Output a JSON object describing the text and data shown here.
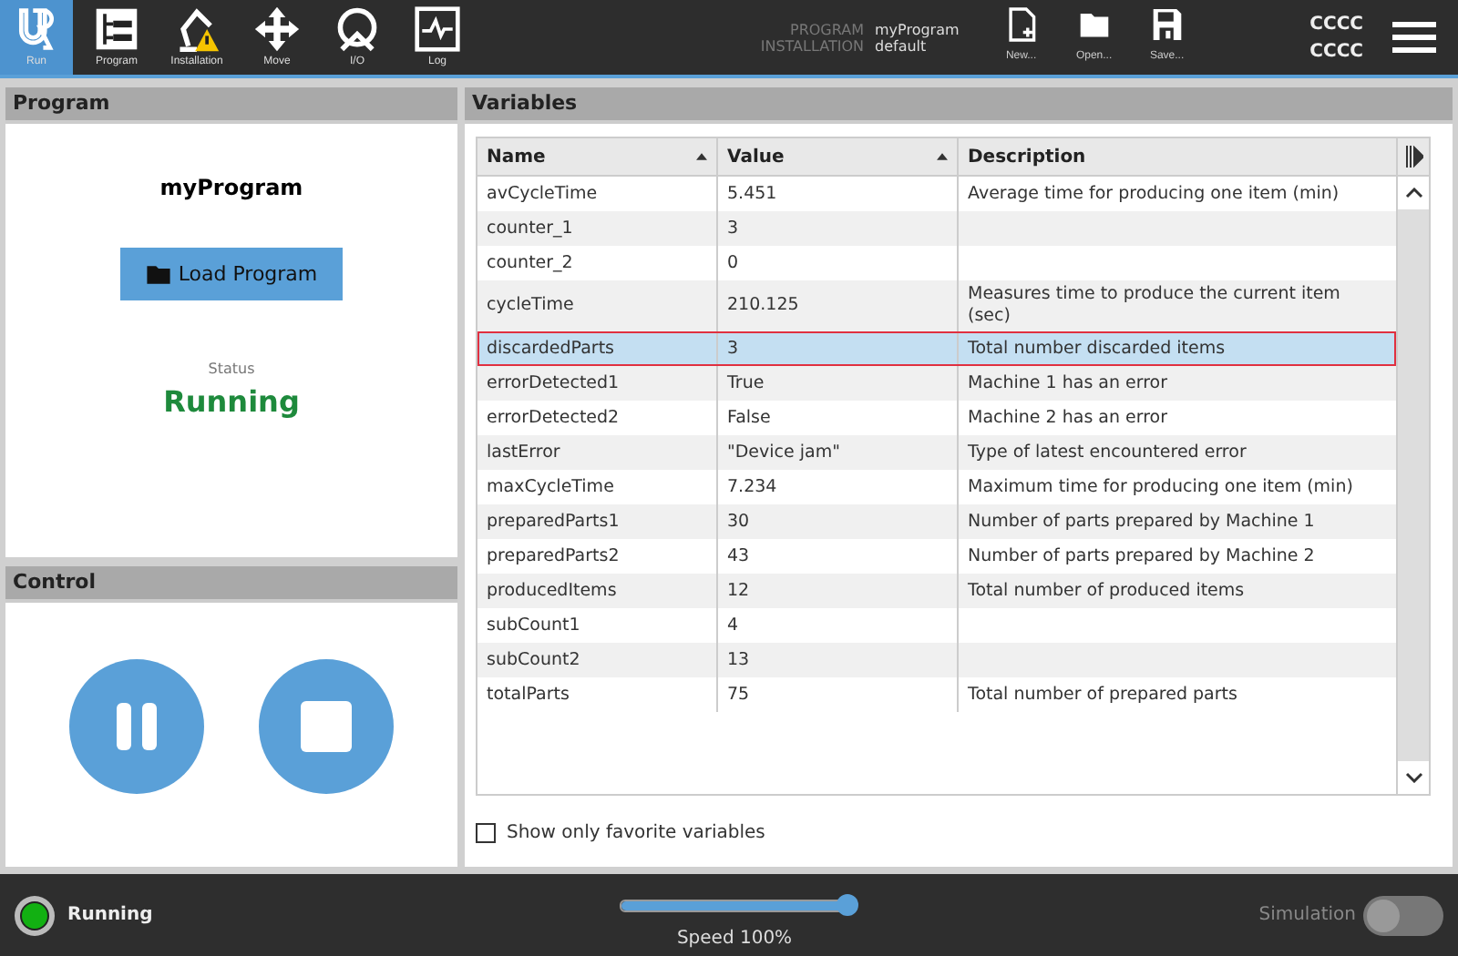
{
  "nav": [
    {
      "label": "Run",
      "kind": "logo",
      "selected": true
    },
    {
      "label": "Program",
      "kind": "program",
      "selected": false
    },
    {
      "label": "Installation",
      "kind": "installation",
      "selected": false
    },
    {
      "label": "Move",
      "kind": "move",
      "selected": false
    },
    {
      "label": "I/O",
      "kind": "io",
      "selected": false
    },
    {
      "label": "Log",
      "kind": "log",
      "selected": false
    }
  ],
  "header_info": [
    {
      "label": "PROGRAM",
      "value": "myProgram"
    },
    {
      "label": "INSTALLATION",
      "value": "default"
    }
  ],
  "file_buttons": [
    {
      "label": "New...",
      "kind": "new"
    },
    {
      "label": "Open...",
      "kind": "open"
    },
    {
      "label": "Save...",
      "kind": "save"
    }
  ],
  "robot_name": [
    "CCCC",
    "CCCC"
  ],
  "program_panel": {
    "title": "Program",
    "program_name": "myProgram",
    "load_button": "Load Program",
    "status_label": "Status",
    "status": "Running"
  },
  "control_panel": {
    "title": "Control",
    "buttons": [
      {
        "kind": "pause"
      },
      {
        "kind": "stop"
      }
    ]
  },
  "variables": {
    "title": "Variables",
    "columns": [
      {
        "label": "Name",
        "sortable": true
      },
      {
        "label": "Value",
        "sortable": true
      },
      {
        "label": "Description",
        "sortable": false
      }
    ],
    "rows": [
      {
        "name": "avCycleTime",
        "value": "5.451",
        "description": "Average time for producing one item (min)",
        "selected": false,
        "highlighted": false
      },
      {
        "name": "counter_1",
        "value": "3",
        "description": "",
        "selected": false,
        "highlighted": false
      },
      {
        "name": "counter_2",
        "value": "0",
        "description": "",
        "selected": false,
        "highlighted": false
      },
      {
        "name": "cycleTime",
        "value": "210.125",
        "description": "Measures time to produce the current item (sec)",
        "selected": false,
        "highlighted": false
      },
      {
        "name": "discardedParts",
        "value": "3",
        "description": "Total number discarded items",
        "selected": true,
        "highlighted": true
      },
      {
        "name": "errorDetected1",
        "value": "True",
        "description": "Machine 1 has an error",
        "selected": false,
        "highlighted": false
      },
      {
        "name": "errorDetected2",
        "value": "False",
        "description": "Machine 2 has an error",
        "selected": false,
        "highlighted": false
      },
      {
        "name": "lastError",
        "value": "\"Device jam\"",
        "description": "Type of latest encountered error",
        "selected": false,
        "highlighted": false
      },
      {
        "name": "maxCycleTime",
        "value": "7.234",
        "description": "Maximum time for producing one item (min)",
        "selected": false,
        "highlighted": false
      },
      {
        "name": "preparedParts1",
        "value": "30",
        "description": "Number of parts prepared by Machine 1",
        "selected": false,
        "highlighted": false
      },
      {
        "name": "preparedParts2",
        "value": "43",
        "description": "Number of parts prepared by Machine 2",
        "selected": false,
        "highlighted": false
      },
      {
        "name": "producedItems",
        "value": "12",
        "description": "Total number of produced items",
        "selected": false,
        "highlighted": false
      },
      {
        "name": "subCount1",
        "value": "4",
        "description": "",
        "selected": false,
        "highlighted": false
      },
      {
        "name": "subCount2",
        "value": "13",
        "description": "",
        "selected": false,
        "highlighted": false
      },
      {
        "name": "totalParts",
        "value": "75",
        "description": "Total number of prepared parts",
        "selected": false,
        "highlighted": false
      }
    ],
    "favorites_only": {
      "label": "Show only favorite variables",
      "checked": false
    }
  },
  "status_bar": {
    "state": "Running",
    "running": true,
    "speed": {
      "level": 1,
      "label": "Speed 100%"
    },
    "simulation": {
      "label": "Simulation",
      "on": false
    }
  }
}
